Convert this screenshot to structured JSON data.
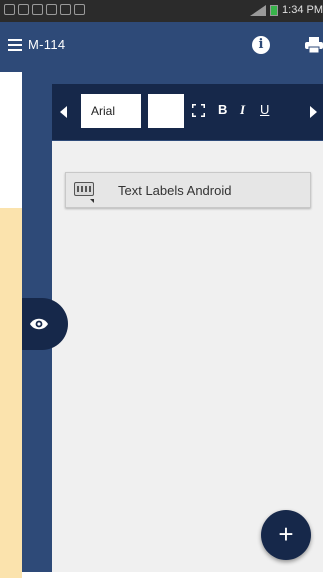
{
  "statusbar": {
    "time": "1:34 PM"
  },
  "appbar": {
    "title": "M-114"
  },
  "toolbar": {
    "font": "Arial",
    "font_size": "",
    "bold": "B",
    "italic": "I",
    "underline": "U"
  },
  "canvas": {
    "items": [
      {
        "label": "Text Labels Android"
      }
    ]
  },
  "fab": {
    "label": "+"
  },
  "colors": {
    "primary": "#2e4a78",
    "dark": "#16284a",
    "canvas_bg": "#f0f0f0",
    "accent_bg": "#fbe3ad"
  }
}
